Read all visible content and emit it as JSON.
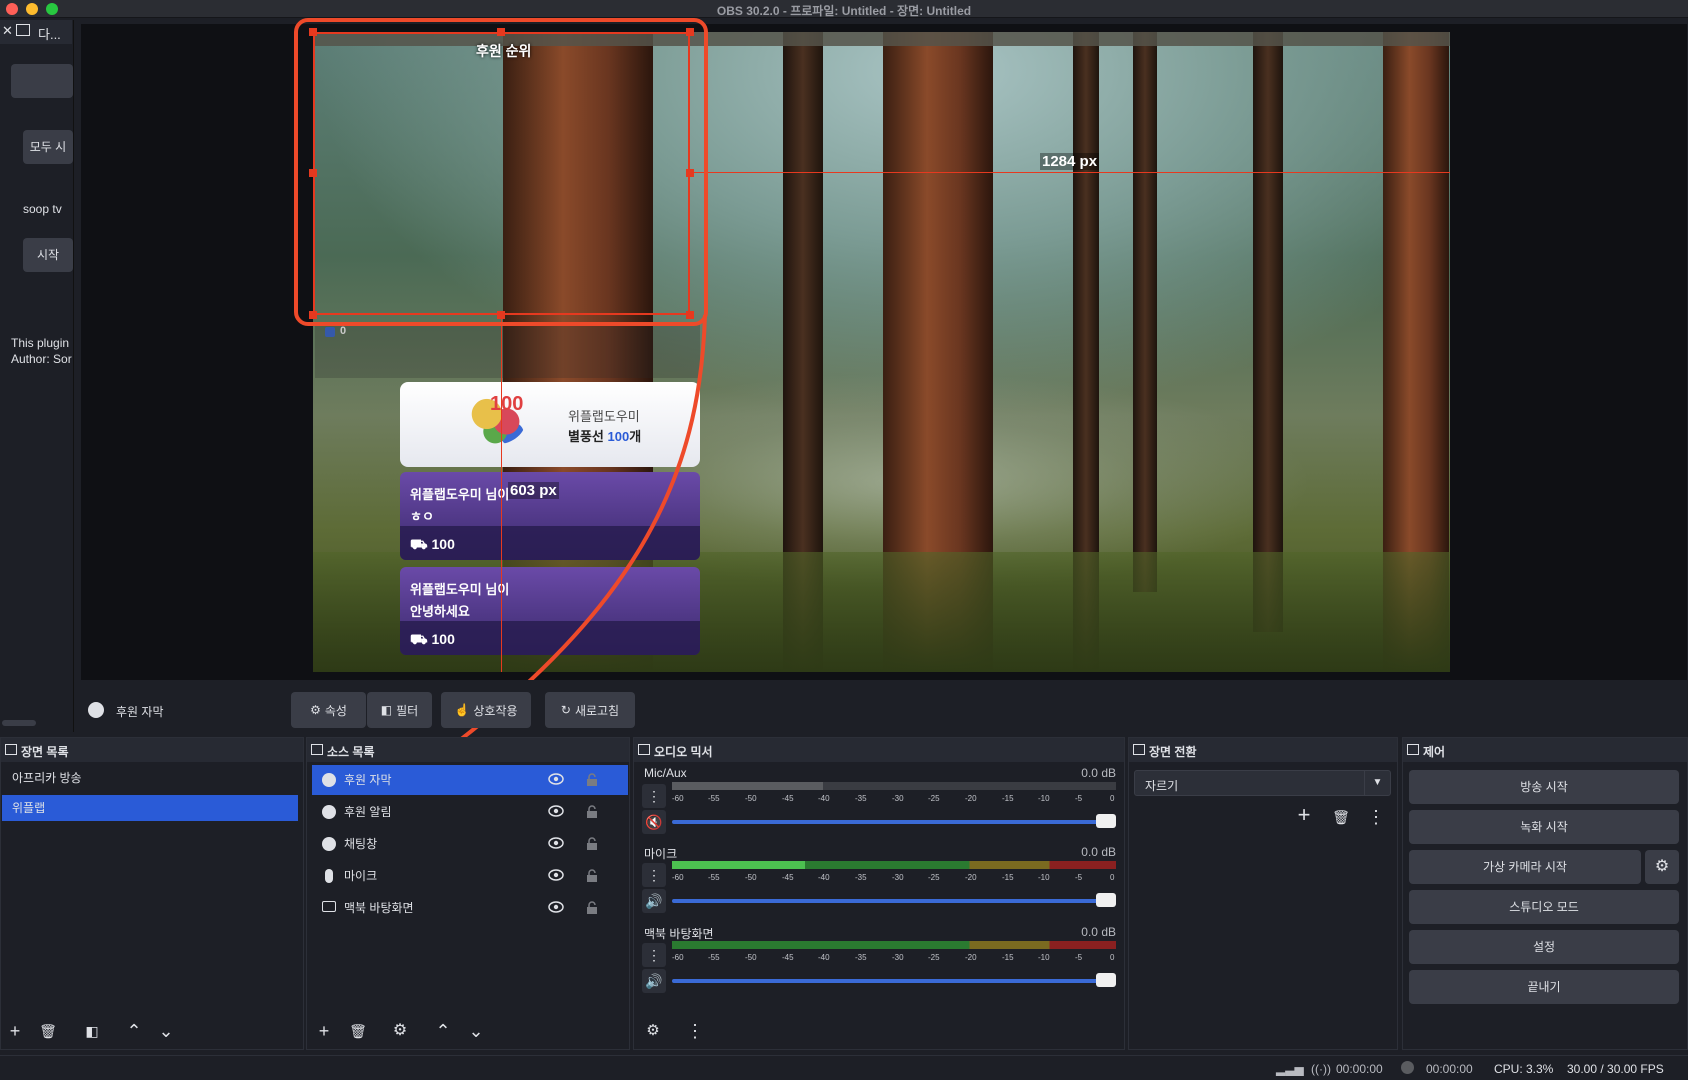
{
  "window": {
    "title": "OBS 30.2.0 - 프로파일: Untitled - 장면: Untitled"
  },
  "left_dock": {
    "header": "다...",
    "button_all": "모두 시",
    "label_soop": "soop tv",
    "button_start": "시작",
    "plugin_line1": "This plugin",
    "plugin_line2": "Author: Sor"
  },
  "preview": {
    "overlay_title": "후원 순위",
    "counter_value": "0",
    "selection_width": "1284 px",
    "selection_height": "603 px",
    "alert": {
      "name": "위플랩도우미",
      "text_prefix": "별풍선 ",
      "amount": "100",
      "text_suffix": "개",
      "balloon_number": "100"
    },
    "chats": [
      {
        "name": "위플랩도우미 님이",
        "message": "ㅎㅇ",
        "amount": "100"
      },
      {
        "name": "위플랩도우미 님이",
        "message": "안녕하세요",
        "amount": "100"
      }
    ]
  },
  "context_bar": {
    "source_name": "후원 자막",
    "properties": "속성",
    "filters": "필터",
    "interact": "상호작용",
    "refresh": "새로고침"
  },
  "scenes": {
    "title": "장면 목록",
    "items": [
      "아프리카 방송",
      "위플랩"
    ],
    "selected_index": 1
  },
  "sources": {
    "title": "소스 목록",
    "items": [
      {
        "name": "후원 자막",
        "icon": "globe-icon"
      },
      {
        "name": "후원 알림",
        "icon": "globe-icon"
      },
      {
        "name": "채팅창",
        "icon": "globe-icon"
      },
      {
        "name": "마이크",
        "icon": "mic-icon"
      },
      {
        "name": "맥북 바탕화면",
        "icon": "monitor-icon"
      }
    ],
    "selected_index": 0
  },
  "mixer": {
    "title": "오디오 믹서",
    "ticks": [
      "-60",
      "-55",
      "-50",
      "-45",
      "-40",
      "-35",
      "-30",
      "-25",
      "-20",
      "-15",
      "-10",
      "-5",
      "0"
    ],
    "channels": [
      {
        "name": "Mic/Aux",
        "db": "0.0 dB",
        "muted": true
      },
      {
        "name": "마이크",
        "db": "0.0 dB",
        "muted": false
      },
      {
        "name": "맥북 바탕화면",
        "db": "0.0 dB",
        "muted": false
      }
    ]
  },
  "transitions": {
    "title": "장면 전환",
    "selected": "자르기"
  },
  "controls": {
    "title": "제어",
    "start_stream": "방송 시작",
    "start_record": "녹화 시작",
    "start_virtualcam": "가상 카메라 시작",
    "studio_mode": "스튜디오 모드",
    "settings": "설정",
    "exit": "끝내기"
  },
  "status": {
    "stream_time": "00:00:00",
    "record_time": "00:00:00",
    "cpu": "CPU: 3.3%",
    "fps": "30.00 / 30.00 FPS"
  },
  "colors": {
    "accent": "#2a5bd7",
    "annotation": "#e6391f",
    "panel": "#1d1f26"
  }
}
